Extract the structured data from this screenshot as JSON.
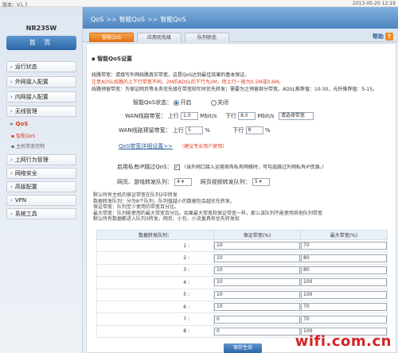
{
  "topbar": {
    "version": "版本：V1.7",
    "datetime": "2013-05-20 12:19"
  },
  "sidebar": {
    "model": "NR235W",
    "home": "首 页",
    "items": [
      {
        "label": "运行状态"
      },
      {
        "label": "外网接入配置"
      },
      {
        "label": "内网接入配置"
      },
      {
        "label": "无线管理"
      },
      {
        "label": "QoS",
        "active": true
      },
      {
        "label": "上网行为管理"
      },
      {
        "label": "网络安全"
      },
      {
        "label": "高级配置"
      },
      {
        "label": "VPN"
      },
      {
        "label": "系统工具"
      }
    ],
    "sub_items": [
      "智能QoS",
      "主机带宽控制"
    ]
  },
  "breadcrumb": [
    "QoS",
    "智能QoS",
    "智能QoS"
  ],
  "tabs": [
    "智能QoS",
    "应用优先级",
    "队列状态"
  ],
  "help": {
    "label": "帮助",
    "icon": "?"
  },
  "section_title": "智能QoS设置",
  "desc": {
    "line1": "线路带宽：请填写外网线路真实带宽，这是QoS达到最佳效果的基本保证。",
    "line2": "注意ADSL线路的上下行带宽不同。2M的ADSL的下行为2M，而上行一般为0.5M或0.6M。",
    "line3": "线路预留带宽：为保证网页等业务优先级在带宽较忙时优先转发；需要为之预留部分带宽。ADSL推荐值：10-30，光纤推荐值：5-15。"
  },
  "form": {
    "qos_status_label": "智能QoS状态：",
    "on_label": "开启",
    "off_label": "关闭",
    "wan_bw_label": "WAN线路带宽：",
    "up_label": "上行",
    "down_label": "下行",
    "up_value": "1.0",
    "down_value": "8.0",
    "unit_mbps": "Mbit/s",
    "bw_select": "请选择带宽",
    "reserve_label": "WAN线路预留带宽：",
    "up_reserve": "5",
    "down_reserve": "8",
    "percent": "%",
    "detail_link": "QoS带宽详细设置>>",
    "detail_note": "（建议专业用户使用）",
    "private_ip_label": "启用私有IP跳过QoS：",
    "private_ip_note": "（当外网口接入运营商有私有网络时，可勾选跳过外网私有IP资源。）",
    "web_game_label": "网页、游戏转发队列：",
    "web_game_value": "4",
    "video_label": "网页视频转发队列：",
    "video_value": "5"
  },
  "info": [
    "默认所有主机的保证带宽在队列2中转发",
    "数据转发队列：分为8个队列，队列值越小的数据包会越优先转发。",
    "保证带宽：队列至少使用的带宽百分比。",
    "最大带宽：队列能使用的最大带宽百分比。如果最大带宽和保证带宽一样，那么该队列不能使用其他队列带宽",
    "默认所有数据都进入队列3转发，网页、小包、小流量具有优先转发权"
  ],
  "table": {
    "headers": [
      "数据转发队列：",
      "保证带宽(%)",
      "最大带宽(%)"
    ],
    "rows": [
      {
        "queue": "1 :",
        "min": "10",
        "max": "70"
      },
      {
        "queue": "2 :",
        "min": "10",
        "max": "80"
      },
      {
        "queue": "3 :",
        "min": "10",
        "max": "80"
      },
      {
        "queue": "4 :",
        "min": "10",
        "max": "100"
      },
      {
        "queue": "5 :",
        "min": "10",
        "max": "100"
      },
      {
        "queue": "6 :",
        "min": "10",
        "max": "70"
      },
      {
        "queue": "7 :",
        "min": "0",
        "max": "70"
      },
      {
        "queue": "8 :",
        "min": "0",
        "max": "100"
      }
    ]
  },
  "save_button": "保存生效",
  "watermark": "wifi.com.cn"
}
